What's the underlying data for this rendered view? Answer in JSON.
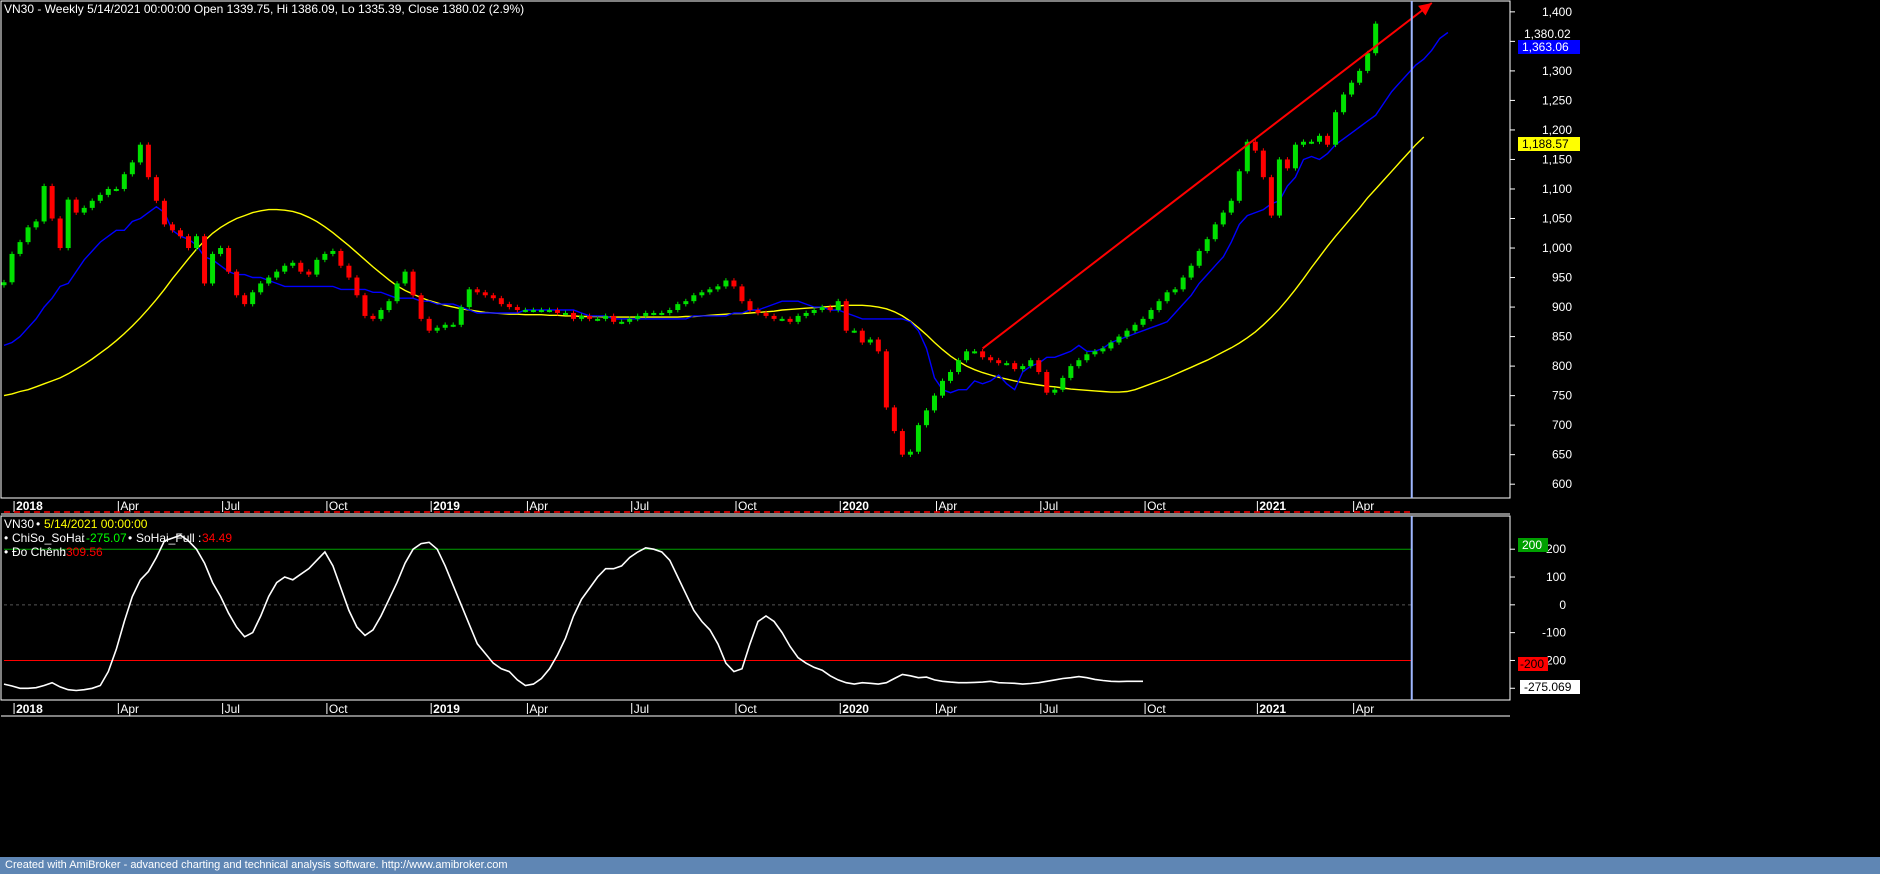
{
  "app": {
    "footer_text": "Created with AmiBroker - advanced charting and technical analysis software. http://www.amibroker.com"
  },
  "colors": {
    "background": "#000000",
    "bull_candle": "#00e000",
    "bear_candle": "#ff0000",
    "ma_fast": "#0000ff",
    "ma_slow": "#ffff00",
    "trend_arrow": "#ff0000",
    "cursor_line": "#9fb7ff",
    "oscillator": "#ffffff",
    "upper_band": "#00a000",
    "lower_band": "#ff0000",
    "footer_bg": "#5f86b4"
  },
  "price_panel": {
    "title": "VN30 - Weekly 5/14/2021 00:00:00 Open 1339.75, Hi 1386.09, Lo 1335.39, Close 1380.02 (2.9%)",
    "last_price_label": "1,380.02",
    "ma_fast_label": "1,363.06",
    "ma_slow_label": "1,188.57"
  },
  "indicator_panel": {
    "title_symbol": "VN30",
    "title_date": "5/14/2021 00:00:00",
    "legend": [
      {
        "name": "ChiSo_SoHai",
        "value": "-275.07",
        "name_color": "#ffffff",
        "value_color": "#00ff00"
      },
      {
        "name": "SoHai_Full",
        "value": "34.49",
        "name_color": "#ffffff",
        "value_color": "#ff0000"
      },
      {
        "name": "Đo Chênh",
        "value": "309.56",
        "name_color": "#ffffff",
        "value_color": "#ff0000"
      }
    ],
    "band_labels": {
      "upper": "200",
      "lower": "-200"
    },
    "last_value_label": "-275.069"
  },
  "x_axis_labels": [
    {
      "label": "2018",
      "bold": true,
      "week": 3
    },
    {
      "label": "Apr",
      "bold": false,
      "week": 16
    },
    {
      "label": "Jul",
      "bold": false,
      "week": 29
    },
    {
      "label": "Oct",
      "bold": false,
      "week": 42
    },
    {
      "label": "2019",
      "bold": true,
      "week": 55
    },
    {
      "label": "Apr",
      "bold": false,
      "week": 67
    },
    {
      "label": "Jul",
      "bold": false,
      "week": 80
    },
    {
      "label": "Oct",
      "bold": false,
      "week": 93
    },
    {
      "label": "2020",
      "bold": true,
      "week": 106
    },
    {
      "label": "Apr",
      "bold": false,
      "week": 118
    },
    {
      "label": "Jul",
      "bold": false,
      "week": 131
    },
    {
      "label": "Oct",
      "bold": false,
      "week": 144
    },
    {
      "label": "2021",
      "bold": true,
      "week": 158
    },
    {
      "label": "Apr",
      "bold": false,
      "week": 170
    }
  ],
  "chart_data": [
    {
      "type": "candlestick",
      "title": "VN30 - Weekly 5/14/2021 00:00:00 Open 1339.75, Hi 1386.09, Lo 1335.39, Close 1380.02 (2.9%)",
      "y_ticks": [
        600,
        650,
        700,
        750,
        800,
        850,
        900,
        950,
        1000,
        1050,
        1100,
        1150,
        1200,
        1250,
        1300,
        1350,
        1400
      ],
      "ylim": [
        580,
        1415
      ],
      "x_range_weeks": [
        0,
        187
      ],
      "last_bar_week": 175,
      "closes": [
        942,
        990,
        1010,
        1035,
        1045,
        1105,
        1050,
        1000,
        1082,
        1060,
        1068,
        1080,
        1090,
        1100,
        1100,
        1125,
        1145,
        1175,
        1120,
        1080,
        1040,
        1030,
        1020,
        1000,
        1020,
        940,
        990,
        1000,
        960,
        920,
        905,
        925,
        940,
        950,
        960,
        970,
        975,
        960,
        955,
        980,
        990,
        995,
        970,
        950,
        920,
        885,
        880,
        895,
        910,
        940,
        960,
        920,
        880,
        860,
        865,
        870,
        870,
        900,
        930,
        925,
        920,
        915,
        905,
        900,
        895,
        895,
        895,
        895,
        895,
        890,
        890,
        880,
        885,
        880,
        880,
        885,
        875,
        875,
        880,
        885,
        890,
        890,
        890,
        895,
        905,
        910,
        920,
        925,
        930,
        935,
        945,
        935,
        910,
        895,
        890,
        885,
        880,
        880,
        875,
        885,
        890,
        895,
        900,
        895,
        910,
        860,
        860,
        840,
        845,
        825,
        730,
        690,
        650,
        655,
        700,
        725,
        750,
        775,
        790,
        810,
        825,
        825,
        815,
        810,
        805,
        805,
        795,
        800,
        810,
        790,
        755,
        760,
        780,
        800,
        810,
        820,
        825,
        830,
        840,
        850,
        860,
        870,
        880,
        895,
        910,
        925,
        930,
        950,
        970,
        995,
        1015,
        1040,
        1060,
        1080,
        1130,
        1180,
        1165,
        1120,
        1055,
        1150,
        1135,
        1175,
        1180,
        1180,
        1190,
        1175,
        1230,
        1260,
        1280,
        1300,
        1330,
        1380
      ],
      "ma_fast": [
        835,
        840,
        850,
        865,
        880,
        900,
        915,
        935,
        940,
        960,
        980,
        995,
        1010,
        1020,
        1030,
        1030,
        1045,
        1050,
        1060,
        1070,
        1060,
        1030,
        1020,
        1015,
        1005,
        985,
        980,
        970,
        960,
        955,
        955,
        950,
        950,
        945,
        940,
        935,
        935,
        935,
        935,
        935,
        935,
        935,
        930,
        930,
        930,
        930,
        925,
        925,
        920,
        915,
        915,
        915,
        910,
        910,
        905,
        905,
        905,
        900,
        895,
        890,
        890,
        890,
        890,
        890,
        890,
        895,
        895,
        895,
        895,
        895,
        895,
        895,
        890,
        885,
        885,
        885,
        880,
        880,
        880,
        880,
        880,
        880,
        880,
        880,
        880,
        880,
        885,
        885,
        885,
        885,
        885,
        890,
        890,
        895,
        895,
        900,
        905,
        910,
        910,
        910,
        905,
        900,
        900,
        895,
        895,
        890,
        885,
        880,
        880,
        880,
        880,
        880,
        880,
        875,
        860,
        830,
        780,
        760,
        755,
        760,
        760,
        775,
        770,
        775,
        785,
        770,
        760,
        790,
        800,
        805,
        815,
        815,
        820,
        825,
        835,
        825,
        825,
        830,
        840,
        845,
        850,
        855,
        860,
        865,
        870,
        875,
        890,
        905,
        920,
        940,
        955,
        970,
        985,
        1010,
        1040,
        1055,
        1060,
        1065,
        1075,
        1080,
        1105,
        1120,
        1150,
        1155,
        1150,
        1160,
        1175,
        1185,
        1195,
        1205,
        1215,
        1225,
        1245,
        1265,
        1280,
        1295,
        1310,
        1320,
        1335,
        1355,
        1365
      ],
      "ma_slow": [
        750,
        753,
        757,
        760,
        765,
        770,
        775,
        780,
        787,
        795,
        803,
        812,
        822,
        832,
        843,
        855,
        868,
        882,
        897,
        913,
        930,
        948,
        965,
        982,
        998,
        1012,
        1025,
        1035,
        1043,
        1050,
        1055,
        1060,
        1063,
        1065,
        1065,
        1064,
        1062,
        1058,
        1052,
        1045,
        1036,
        1026,
        1015,
        1004,
        992,
        980,
        968,
        957,
        946,
        936,
        928,
        922,
        916,
        911,
        907,
        903,
        900,
        897,
        895,
        893,
        891,
        890,
        889,
        888,
        888,
        887,
        887,
        887,
        886,
        886,
        885,
        885,
        884,
        884,
        884,
        883,
        883,
        883,
        883,
        883,
        883,
        883,
        883,
        883,
        883,
        884,
        884,
        885,
        886,
        887,
        888,
        889,
        889,
        890,
        891,
        892,
        893,
        895,
        896,
        897,
        898,
        899,
        900,
        901,
        902,
        903,
        903,
        903,
        902,
        900,
        897,
        892,
        885,
        876,
        865,
        853,
        840,
        828,
        817,
        808,
        800,
        794,
        789,
        785,
        781,
        778,
        775,
        772,
        770,
        768,
        766,
        765,
        763,
        761,
        760,
        759,
        758,
        757,
        756,
        756,
        757,
        760,
        765,
        770,
        775,
        780,
        786,
        792,
        798,
        804,
        810,
        817,
        824,
        831,
        839,
        848,
        858,
        870,
        883,
        897,
        913,
        930,
        948,
        967,
        985,
        1003,
        1020,
        1036,
        1052,
        1068,
        1085,
        1100,
        1115,
        1130,
        1145,
        1160,
        1175,
        1188
      ]
    },
    {
      "type": "line",
      "series": [
        {
          "name": "ChiSo_SoHai",
          "last_value": -275.069
        }
      ],
      "y_ticks": [
        200,
        100,
        0,
        -100,
        -200,
        -300
      ],
      "ylim": [
        -335,
        305
      ],
      "reference_lines": [
        200,
        0,
        -200
      ],
      "values": [
        -285,
        -292,
        -300,
        -300,
        -298,
        -290,
        -280,
        -295,
        -305,
        -308,
        -305,
        -300,
        -290,
        -240,
        -160,
        -60,
        30,
        90,
        120,
        170,
        230,
        240,
        250,
        230,
        200,
        150,
        80,
        30,
        -30,
        -80,
        -115,
        -100,
        -40,
        30,
        80,
        100,
        90,
        110,
        130,
        160,
        190,
        140,
        60,
        -20,
        -80,
        -110,
        -90,
        -40,
        20,
        80,
        150,
        200,
        220,
        225,
        200,
        140,
        70,
        0,
        -70,
        -140,
        -175,
        -210,
        -230,
        -240,
        -270,
        -290,
        -285,
        -265,
        -230,
        -180,
        -120,
        -40,
        20,
        60,
        100,
        130,
        130,
        140,
        170,
        190,
        205,
        200,
        190,
        160,
        100,
        40,
        -20,
        -60,
        -90,
        -140,
        -210,
        -240,
        -230,
        -140,
        -60,
        -40,
        -60,
        -100,
        -150,
        -190,
        -210,
        -225,
        -235,
        -255,
        -270,
        -280,
        -285,
        -280,
        -282,
        -285,
        -280,
        -265,
        -250,
        -255,
        -262,
        -260,
        -270,
        -275,
        -278,
        -280,
        -280,
        -279,
        -278,
        -275,
        -280,
        -281,
        -282,
        -285,
        -283,
        -280,
        -275,
        -270,
        -265,
        -262,
        -258,
        -262,
        -268,
        -272,
        -275,
        -276,
        -275,
        -275,
        -275
      ]
    }
  ]
}
